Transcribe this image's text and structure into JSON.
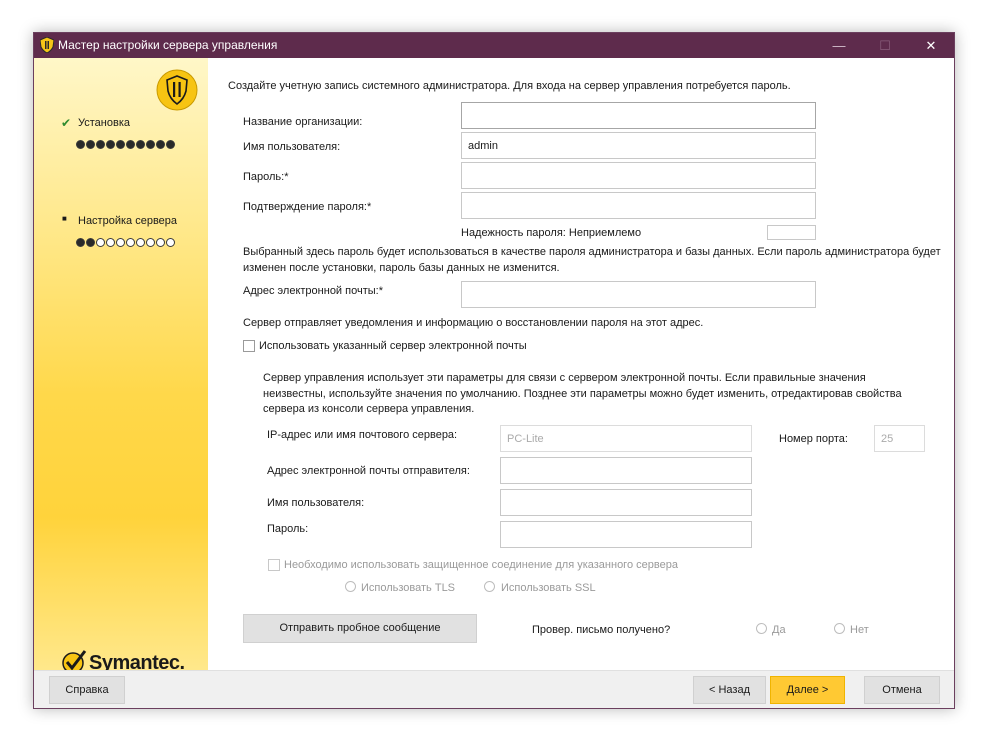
{
  "window": {
    "title": "Мастер настройки сервера управления",
    "controls": {
      "minimize": "—",
      "maximize": "☐",
      "close": "✕"
    },
    "accent": "#5e2b4c"
  },
  "sidebar": {
    "steps": [
      {
        "label": "Установка",
        "marker": "✔",
        "dots_total": 10,
        "dots_filled": 10
      },
      {
        "label": "Настройка сервера",
        "marker": "■",
        "dots_total": 10,
        "dots_filled": 2
      }
    ],
    "brand": "Symantec."
  },
  "form": {
    "intro": "Создайте учетную запись системного администратора. Для входа на сервер управления потребуется пароль.",
    "org_label": "Название организации:",
    "org_value": "",
    "user_label": "Имя пользователя:",
    "user_value": "admin",
    "password_label": "Пароль:*",
    "password_value": "",
    "confirm_label": "Подтверждение пароля:*",
    "confirm_value": "",
    "strength_label": "Надежность пароля: Неприемлемо",
    "password_note_1": "Выбранный здесь пароль будет использоваться в качестве пароля администратора и базы данных. Если пароль администратора будет",
    "password_note_2": "изменен после установки, пароль базы данных не изменится.",
    "email_label": "Адрес электронной почты:*",
    "email_value": "",
    "email_note": "Сервер отправляет уведомления и информацию о восстановлении пароля на этот адрес.",
    "use_mail_server_label": "Использовать указанный сервер электронной почты",
    "use_mail_server_checked": false
  },
  "mail": {
    "desc_1": "Сервер управления использует эти параметры для связи с сервером электронной почты.  Если правильные значения",
    "desc_2": "неизвестны, используйте значения по умолчанию. Позднее эти параметры можно будет изменить, отредактировав свойства",
    "desc_3": "сервера из консоли сервера управления.",
    "server_label": "IP-адрес или имя почтового сервера:",
    "server_value": "PC-Lite",
    "port_label": "Номер порта:",
    "port_value": "25",
    "sender_label": "Адрес электронной почты отправителя:",
    "sender_value": "",
    "user_label": "Имя пользователя:",
    "user_value": "",
    "password_label": "Пароль:",
    "password_value": "",
    "secure_label": "Необходимо использовать защищенное соединение для указанного сервера",
    "tls_label": "Использовать TLS",
    "ssl_label": "Использовать SSL",
    "test_button": "Отправить пробное сообщение",
    "received_label": "Провер. письмо получено?",
    "yes_label": "Да",
    "no_label": "Нет"
  },
  "footer": {
    "help": "Справка",
    "back": "< Назад",
    "next": "Далее >",
    "cancel": "Отмена"
  }
}
